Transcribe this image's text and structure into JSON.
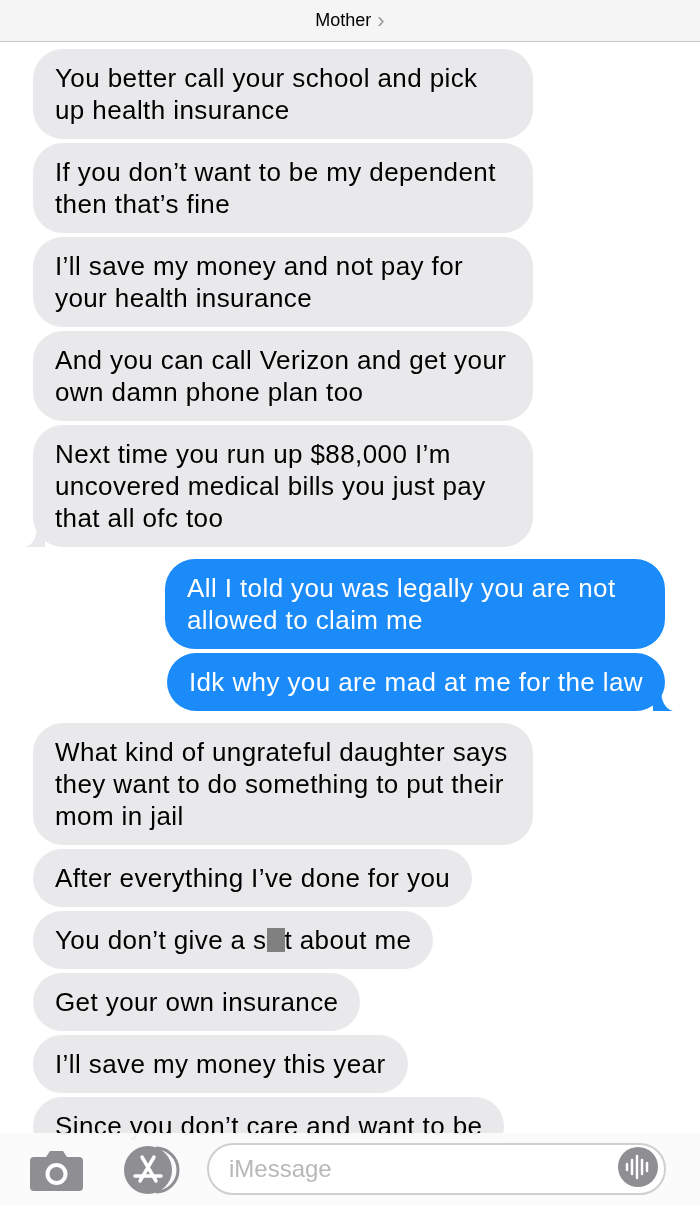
{
  "header": {
    "contact_name": "Mother",
    "chevron": "›"
  },
  "messages": [
    {
      "kind": "incoming",
      "text": "You better call your school and pick up health insurance"
    },
    {
      "kind": "incoming",
      "text": "If you don’t want to be my dependent then that’s fine"
    },
    {
      "kind": "incoming",
      "text": "I’ll save my money and not pay for your health insurance"
    },
    {
      "kind": "incoming",
      "text": "And you can call Verizon and get your own damn phone plan too"
    },
    {
      "kind": "incoming",
      "text": "Next time you run up $88,000 I’m uncovered medical bills you just pay that all ofc too",
      "tail": true
    },
    {
      "kind": "outgoing",
      "text": "All I told you was legally you are not allowed to claim me"
    },
    {
      "kind": "outgoing",
      "text": "Idk why you are mad at me for the law",
      "tail": true
    },
    {
      "kind": "incoming",
      "text": "What kind of ungrateful daughter says they want to do something to put their mom in jail"
    },
    {
      "kind": "incoming",
      "text": "After everything I’ve done for you"
    },
    {
      "kind": "incoming",
      "text": "You don’t give a s",
      "redacted": true,
      "text_after": "t about me"
    },
    {
      "kind": "incoming",
      "text": "Get your own insurance"
    },
    {
      "kind": "incoming",
      "text": "I’ll save my money this year"
    },
    {
      "kind": "incoming",
      "text": "Since you don’t care and want to be"
    }
  ],
  "composer": {
    "placeholder": "iMessage"
  }
}
